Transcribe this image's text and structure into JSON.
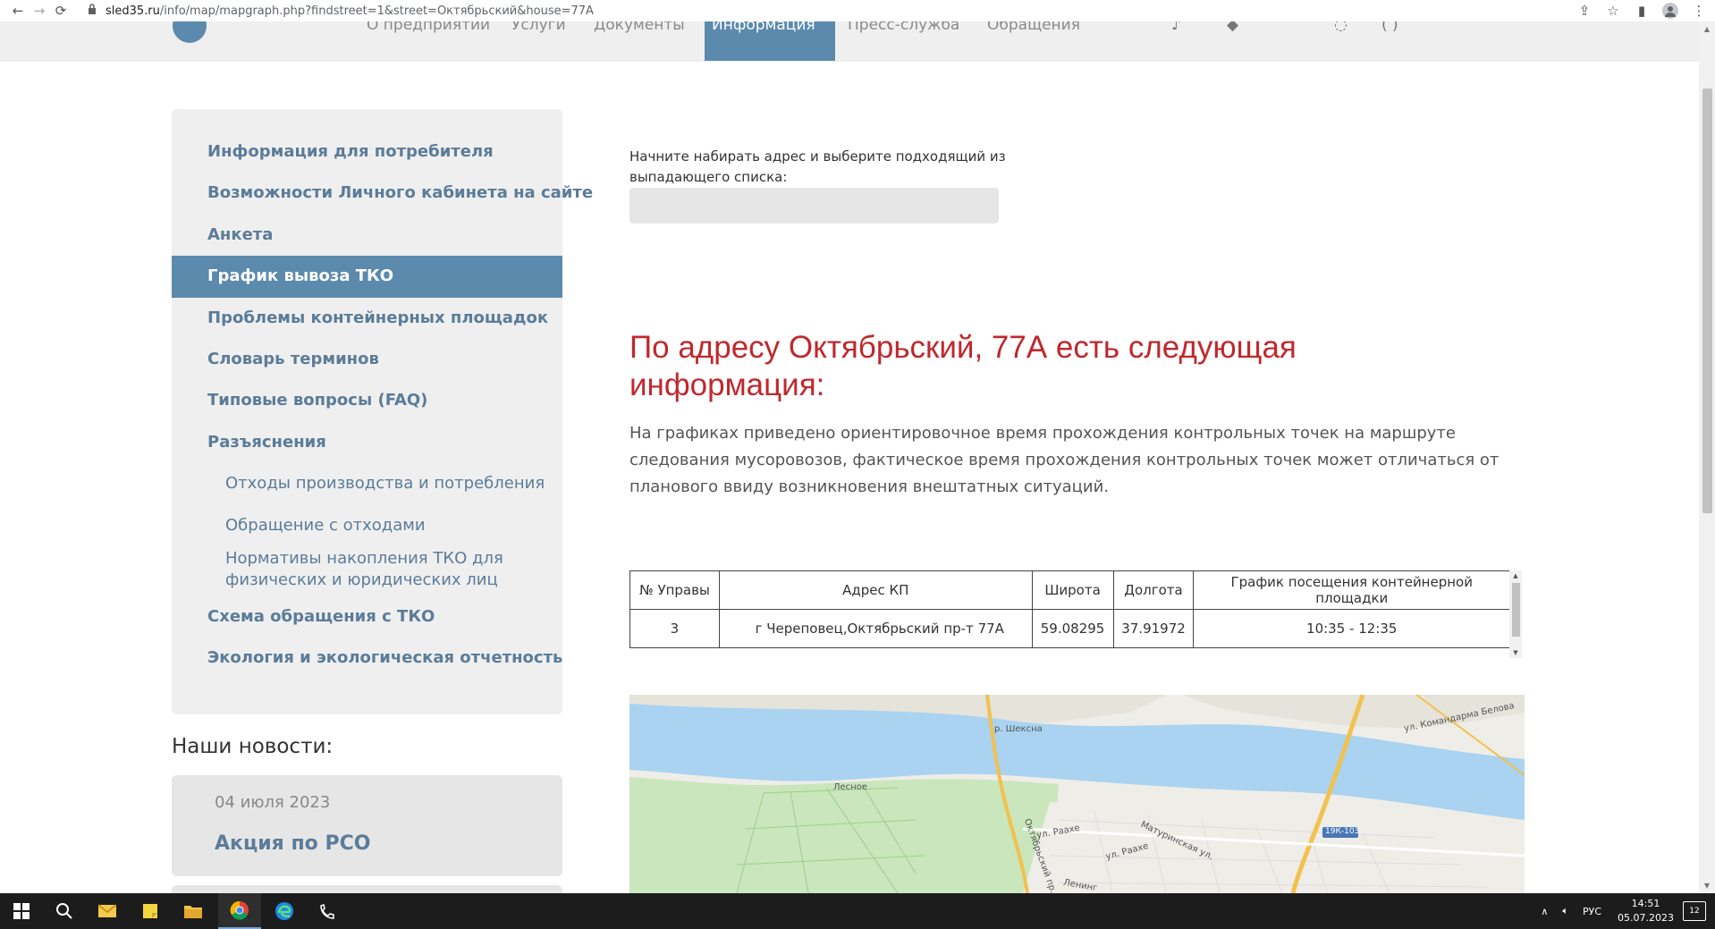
{
  "browser": {
    "url_domain": "sled35.ru",
    "url_rest": "/info/map/mapgraph.php?findstreet=1&street=Октябрьский&house=77A"
  },
  "header": {
    "nav": [
      {
        "label": "О предприятии"
      },
      {
        "label": "Услуги"
      },
      {
        "label": "Документы"
      },
      {
        "label": "Информация"
      },
      {
        "label": "Пресс-служба"
      },
      {
        "label": "Обращения"
      }
    ],
    "active_index": 3
  },
  "sidebar": {
    "items": [
      {
        "label": "Информация для потребителя"
      },
      {
        "label": "Возможности Личного кабинета на сайте"
      },
      {
        "label": "Анкета"
      },
      {
        "label": "График вывоза ТКО"
      },
      {
        "label": "Проблемы контейнерных площадок"
      },
      {
        "label": "Словарь терминов"
      },
      {
        "label": "Типовые вопросы (FAQ)"
      },
      {
        "label": "Разъяснения"
      },
      {
        "label": "Отходы производства и потребления"
      },
      {
        "label": "Обращение с отходами"
      },
      {
        "label_line1": "Нормативы накопления ТКО для",
        "label_line2": "физических и юридических лиц"
      },
      {
        "label": "Схема обращения с ТКО"
      },
      {
        "label": "Экология и экологическая отчетность"
      }
    ]
  },
  "news": {
    "title": "Наши новости:",
    "items": [
      {
        "date": "04 июля 2023",
        "headline": "Акция по РСО"
      }
    ]
  },
  "search": {
    "hint": "Начните набирать адрес и выберите подходящий из выпадающего списка:",
    "value": ""
  },
  "result": {
    "headline": "По адресу Октябрьский, 77А есть следующая информация:",
    "description": "На графиках приведено ориентировочное время прохождения контрольных точек на маршруте следования мусоровозов, фактическое время прохождения контрольных точек может отличаться от планового ввиду возникновения внештатных ситуаций."
  },
  "table": {
    "headers": [
      "№ Управы",
      "Адрес КП",
      "Широта",
      "Долгота",
      "График посещения контейнерной площадки"
    ],
    "rows": [
      [
        "3",
        "г Череповец,Октябрьский пр-т 77А",
        "59.08295",
        "37.91972",
        "10:35 - 12:35"
      ]
    ]
  },
  "map": {
    "labels": {
      "river": "р. Шексна",
      "village": "Лесное",
      "street1": "ул. Командарма Белова",
      "street2": "ул. Раахе",
      "street3": "ул. Раахе",
      "street4": "Матуринская ул.",
      "street5": "Октябрьский пр.",
      "street6": "Ленинг",
      "road": "19К-103"
    },
    "colors": {
      "water": "#a9d3f0",
      "forest": "#c9e6bc",
      "land": "#efede8",
      "road": "#f2c14e"
    }
  },
  "taskbar": {
    "lang": "РУС",
    "time": "14:51",
    "date": "05.07.2023",
    "notifications": "12"
  }
}
